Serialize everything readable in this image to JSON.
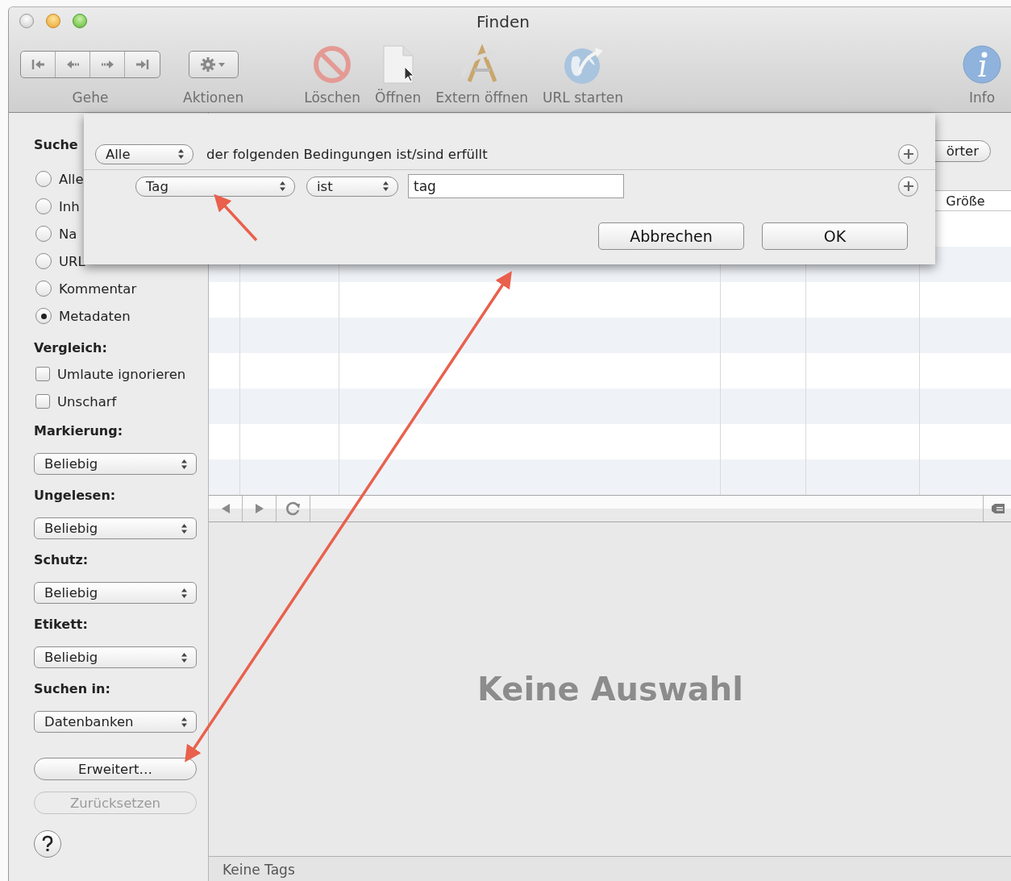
{
  "window": {
    "title": "Finden"
  },
  "toolbar": {
    "items": [
      {
        "kind": "nav",
        "label": "Gehe"
      },
      {
        "kind": "gear",
        "label": "Aktionen"
      },
      {
        "kind": "delete",
        "label": "Löschen"
      },
      {
        "kind": "open",
        "label": "Öffnen"
      },
      {
        "kind": "external",
        "label": "Extern öffnen"
      },
      {
        "kind": "url",
        "label": "URL starten"
      },
      {
        "kind": "info",
        "label": "Info"
      }
    ]
  },
  "sidebar": {
    "search_heading": "Suche",
    "search_options": [
      {
        "label": "Alle",
        "selected": false
      },
      {
        "label": "Inh",
        "selected": false
      },
      {
        "label": "Na",
        "selected": false
      },
      {
        "label": "URL",
        "selected": false
      },
      {
        "label": "Kommentar",
        "selected": false
      },
      {
        "label": "Metadaten",
        "selected": true
      }
    ],
    "compare_heading": "Vergleich:",
    "compare_options": [
      {
        "label": "Umlaute ignorieren",
        "checked": false
      },
      {
        "label": "Unscharf",
        "checked": false
      }
    ],
    "filters": [
      {
        "heading": "Markierung:",
        "value": "Beliebig"
      },
      {
        "heading": "Ungelesen:",
        "value": "Beliebig"
      },
      {
        "heading": "Schutz:",
        "value": "Beliebig"
      },
      {
        "heading": "Etikett:",
        "value": "Beliebig"
      },
      {
        "heading": "Suchen in:",
        "value": "Datenbanken"
      }
    ],
    "buttons": [
      {
        "label": "Erweitert…",
        "disabled": false
      },
      {
        "label": "Zurücksetzen",
        "disabled": true
      }
    ]
  },
  "search_bar": {
    "button": "örter"
  },
  "table": {
    "visible_header": "Größe"
  },
  "preview": {
    "empty_text": "Keine Auswahl"
  },
  "status_bar": {
    "text": "Keine Tags"
  },
  "sheet": {
    "match_popup": "Alle",
    "match_text": "der folgenden Bedingungen ist/sind erfüllt",
    "criteria": [
      {
        "field": "Tag",
        "operator": "ist",
        "value": "tag"
      }
    ],
    "buttons": [
      "Abbrechen",
      "OK"
    ]
  }
}
